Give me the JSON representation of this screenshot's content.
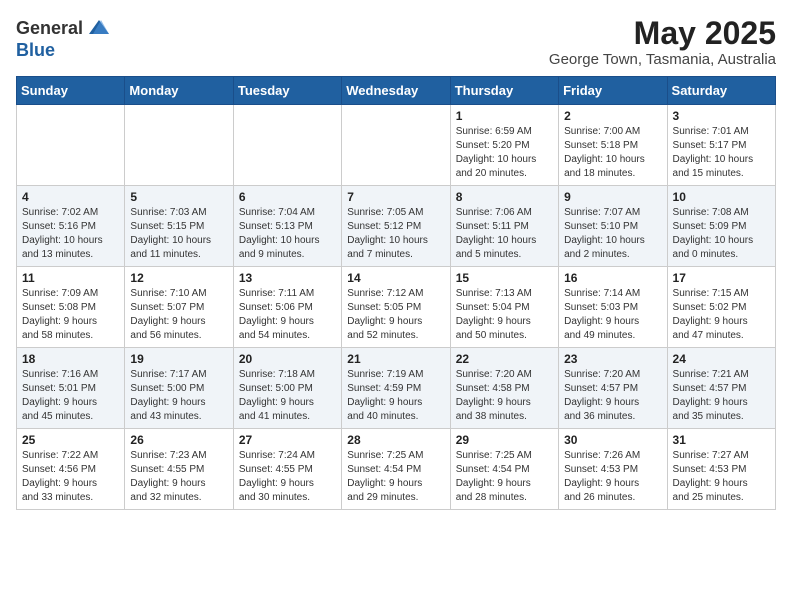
{
  "header": {
    "logo_general": "General",
    "logo_blue": "Blue",
    "month_title": "May 2025",
    "location": "George Town, Tasmania, Australia"
  },
  "weekdays": [
    "Sunday",
    "Monday",
    "Tuesday",
    "Wednesday",
    "Thursday",
    "Friday",
    "Saturday"
  ],
  "weeks": [
    [
      {
        "day": "",
        "info": ""
      },
      {
        "day": "",
        "info": ""
      },
      {
        "day": "",
        "info": ""
      },
      {
        "day": "",
        "info": ""
      },
      {
        "day": "1",
        "info": "Sunrise: 6:59 AM\nSunset: 5:20 PM\nDaylight: 10 hours\nand 20 minutes."
      },
      {
        "day": "2",
        "info": "Sunrise: 7:00 AM\nSunset: 5:18 PM\nDaylight: 10 hours\nand 18 minutes."
      },
      {
        "day": "3",
        "info": "Sunrise: 7:01 AM\nSunset: 5:17 PM\nDaylight: 10 hours\nand 15 minutes."
      }
    ],
    [
      {
        "day": "4",
        "info": "Sunrise: 7:02 AM\nSunset: 5:16 PM\nDaylight: 10 hours\nand 13 minutes."
      },
      {
        "day": "5",
        "info": "Sunrise: 7:03 AM\nSunset: 5:15 PM\nDaylight: 10 hours\nand 11 minutes."
      },
      {
        "day": "6",
        "info": "Sunrise: 7:04 AM\nSunset: 5:13 PM\nDaylight: 10 hours\nand 9 minutes."
      },
      {
        "day": "7",
        "info": "Sunrise: 7:05 AM\nSunset: 5:12 PM\nDaylight: 10 hours\nand 7 minutes."
      },
      {
        "day": "8",
        "info": "Sunrise: 7:06 AM\nSunset: 5:11 PM\nDaylight: 10 hours\nand 5 minutes."
      },
      {
        "day": "9",
        "info": "Sunrise: 7:07 AM\nSunset: 5:10 PM\nDaylight: 10 hours\nand 2 minutes."
      },
      {
        "day": "10",
        "info": "Sunrise: 7:08 AM\nSunset: 5:09 PM\nDaylight: 10 hours\nand 0 minutes."
      }
    ],
    [
      {
        "day": "11",
        "info": "Sunrise: 7:09 AM\nSunset: 5:08 PM\nDaylight: 9 hours\nand 58 minutes."
      },
      {
        "day": "12",
        "info": "Sunrise: 7:10 AM\nSunset: 5:07 PM\nDaylight: 9 hours\nand 56 minutes."
      },
      {
        "day": "13",
        "info": "Sunrise: 7:11 AM\nSunset: 5:06 PM\nDaylight: 9 hours\nand 54 minutes."
      },
      {
        "day": "14",
        "info": "Sunrise: 7:12 AM\nSunset: 5:05 PM\nDaylight: 9 hours\nand 52 minutes."
      },
      {
        "day": "15",
        "info": "Sunrise: 7:13 AM\nSunset: 5:04 PM\nDaylight: 9 hours\nand 50 minutes."
      },
      {
        "day": "16",
        "info": "Sunrise: 7:14 AM\nSunset: 5:03 PM\nDaylight: 9 hours\nand 49 minutes."
      },
      {
        "day": "17",
        "info": "Sunrise: 7:15 AM\nSunset: 5:02 PM\nDaylight: 9 hours\nand 47 minutes."
      }
    ],
    [
      {
        "day": "18",
        "info": "Sunrise: 7:16 AM\nSunset: 5:01 PM\nDaylight: 9 hours\nand 45 minutes."
      },
      {
        "day": "19",
        "info": "Sunrise: 7:17 AM\nSunset: 5:00 PM\nDaylight: 9 hours\nand 43 minutes."
      },
      {
        "day": "20",
        "info": "Sunrise: 7:18 AM\nSunset: 5:00 PM\nDaylight: 9 hours\nand 41 minutes."
      },
      {
        "day": "21",
        "info": "Sunrise: 7:19 AM\nSunset: 4:59 PM\nDaylight: 9 hours\nand 40 minutes."
      },
      {
        "day": "22",
        "info": "Sunrise: 7:20 AM\nSunset: 4:58 PM\nDaylight: 9 hours\nand 38 minutes."
      },
      {
        "day": "23",
        "info": "Sunrise: 7:20 AM\nSunset: 4:57 PM\nDaylight: 9 hours\nand 36 minutes."
      },
      {
        "day": "24",
        "info": "Sunrise: 7:21 AM\nSunset: 4:57 PM\nDaylight: 9 hours\nand 35 minutes."
      }
    ],
    [
      {
        "day": "25",
        "info": "Sunrise: 7:22 AM\nSunset: 4:56 PM\nDaylight: 9 hours\nand 33 minutes."
      },
      {
        "day": "26",
        "info": "Sunrise: 7:23 AM\nSunset: 4:55 PM\nDaylight: 9 hours\nand 32 minutes."
      },
      {
        "day": "27",
        "info": "Sunrise: 7:24 AM\nSunset: 4:55 PM\nDaylight: 9 hours\nand 30 minutes."
      },
      {
        "day": "28",
        "info": "Sunrise: 7:25 AM\nSunset: 4:54 PM\nDaylight: 9 hours\nand 29 minutes."
      },
      {
        "day": "29",
        "info": "Sunrise: 7:25 AM\nSunset: 4:54 PM\nDaylight: 9 hours\nand 28 minutes."
      },
      {
        "day": "30",
        "info": "Sunrise: 7:26 AM\nSunset: 4:53 PM\nDaylight: 9 hours\nand 26 minutes."
      },
      {
        "day": "31",
        "info": "Sunrise: 7:27 AM\nSunset: 4:53 PM\nDaylight: 9 hours\nand 25 minutes."
      }
    ]
  ]
}
